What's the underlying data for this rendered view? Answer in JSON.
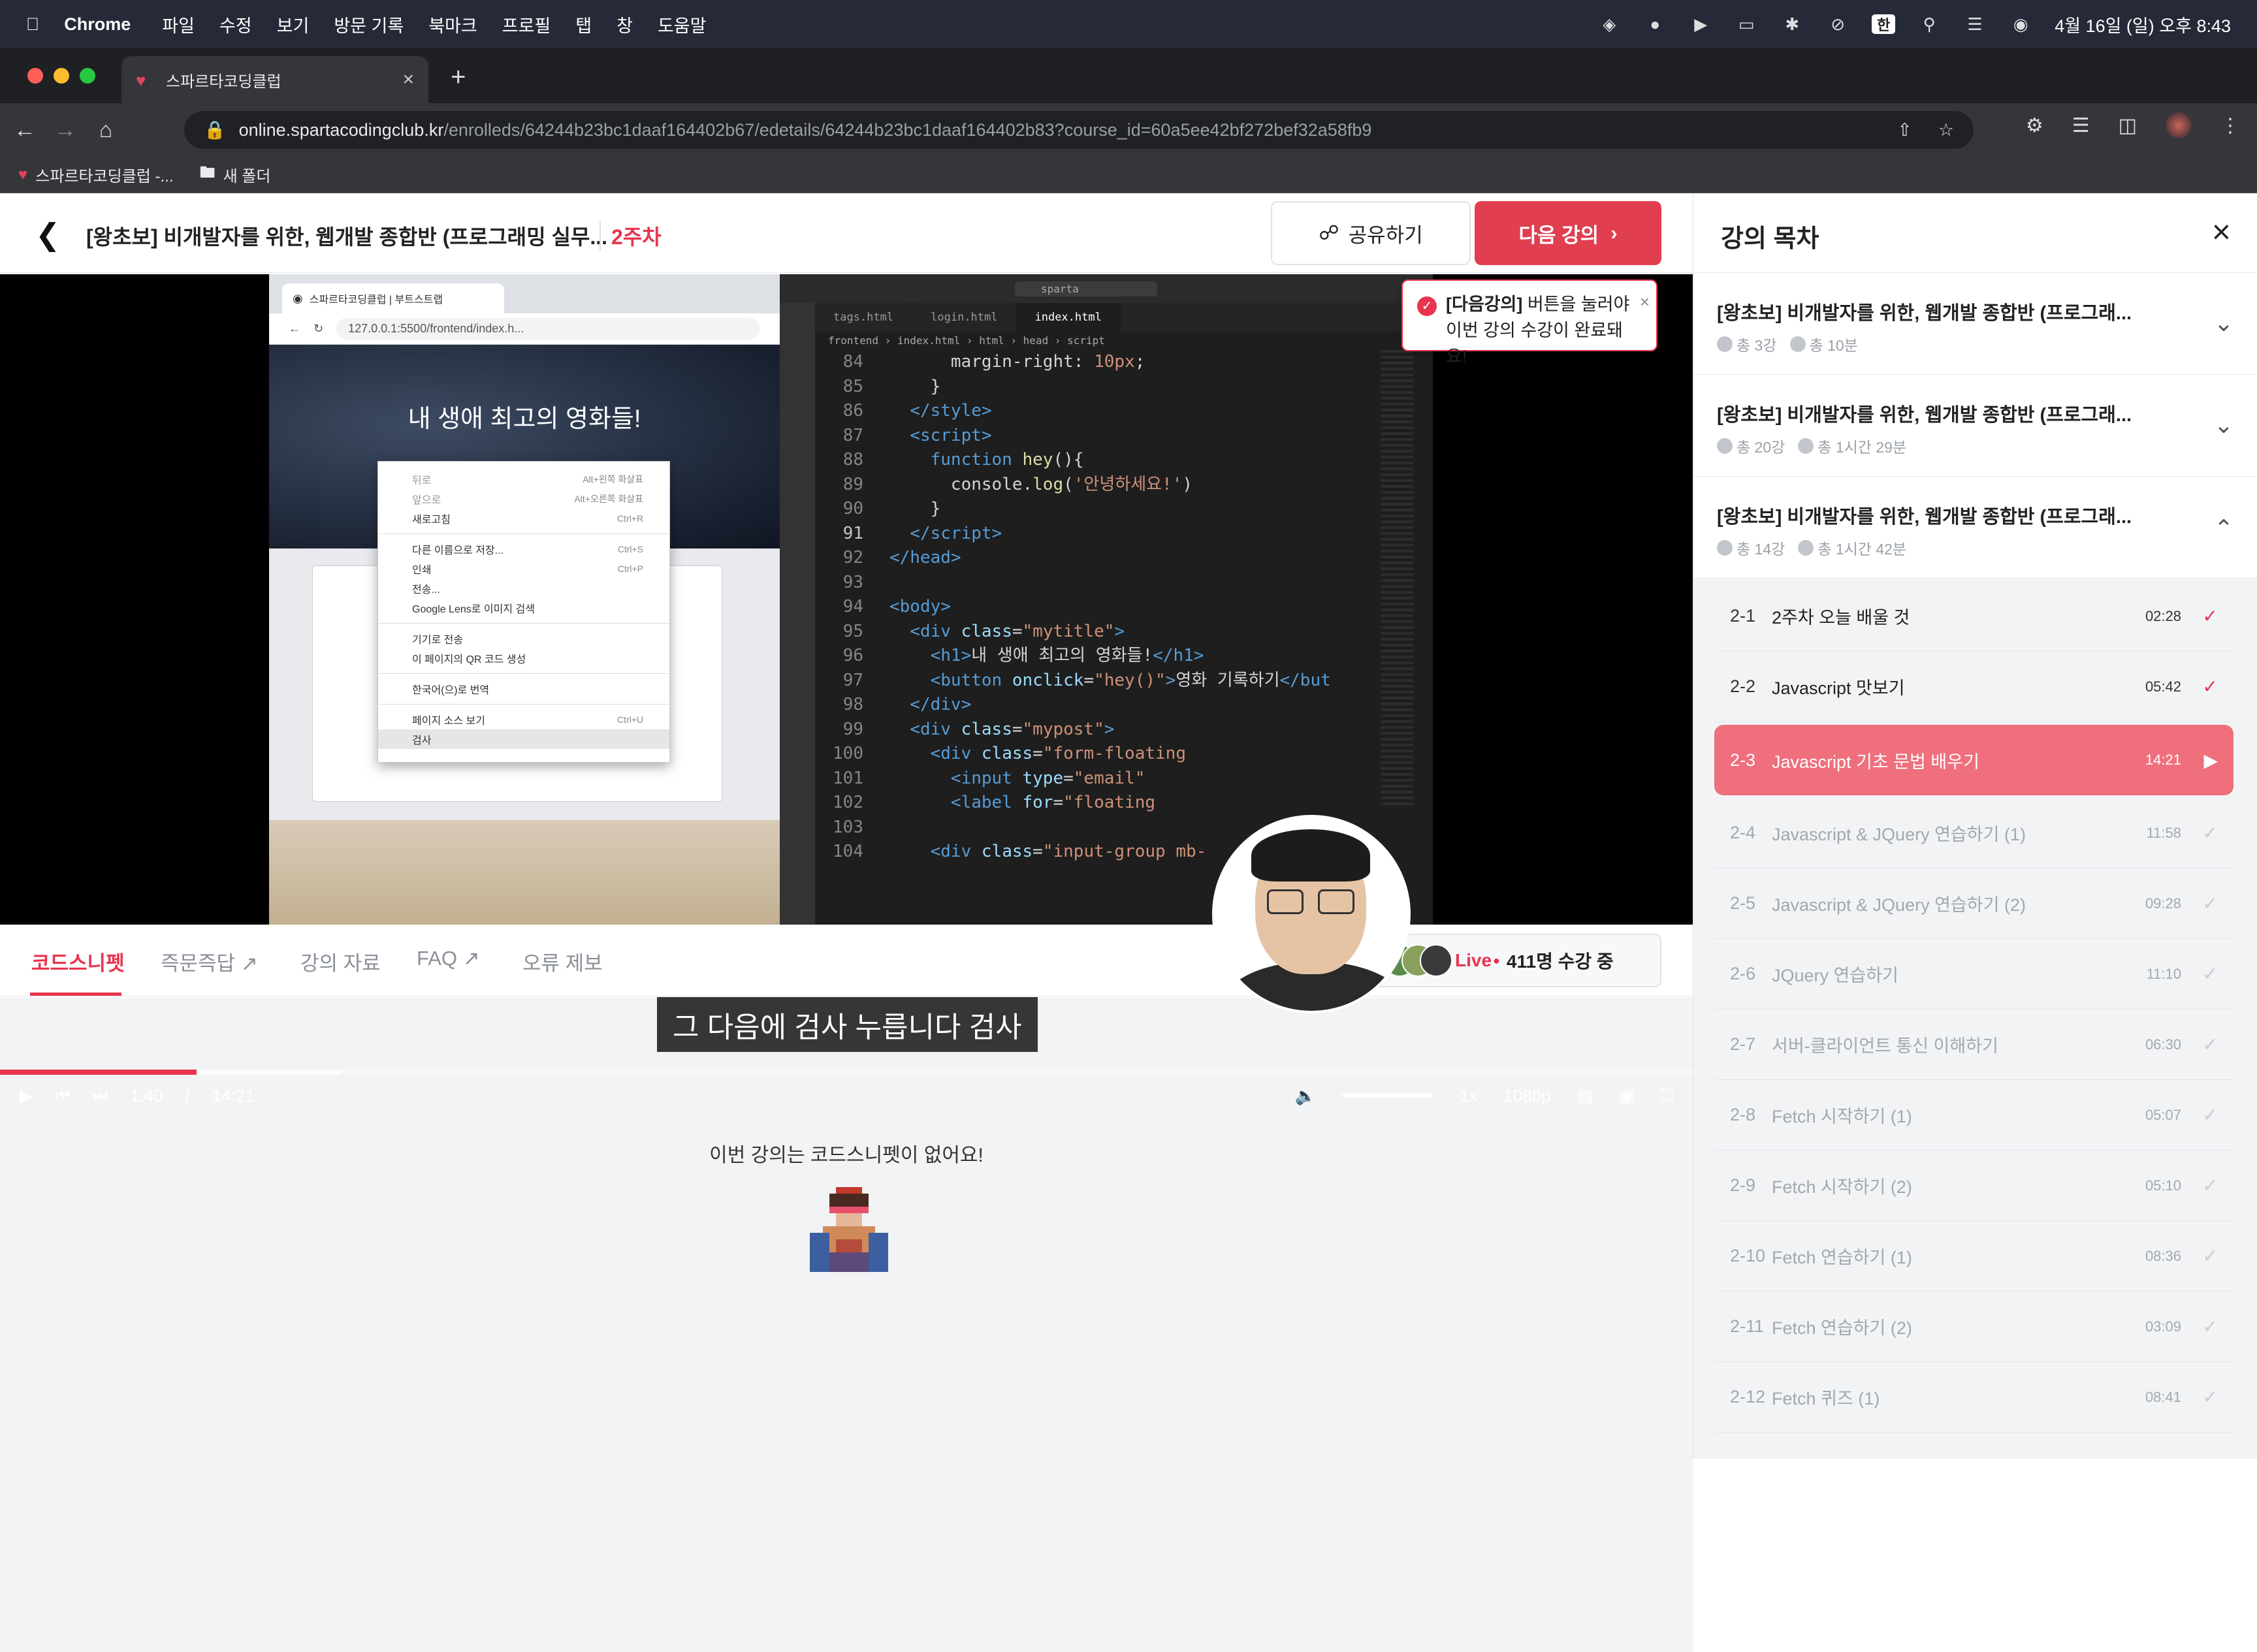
{
  "menubar": {
    "app": "Chrome",
    "items": [
      "파일",
      "수정",
      "보기",
      "방문 기록",
      "북마크",
      "프로필",
      "탭",
      "창",
      "도움말"
    ],
    "input_indicator": "한",
    "datetime": "4월 16일 (일) 오후 8:43"
  },
  "browser": {
    "tab_title": "스파르타코딩클럽",
    "url_host": "online.spartacodingclub.kr",
    "url_path": "/enrolleds/64244b23bc1daaf164402b67/edetails/64244b23bc1daaf164402b83?course_id=60a5ee42bf272bef32a58fb9",
    "bookmarks": [
      "스파르타코딩클럽 -...",
      "새 폴더"
    ]
  },
  "header": {
    "course_title": "[왕초보] 비개발자를 위한, 웹개발 종합반 (프로그래밍 실무...",
    "week": "2주차",
    "share_label": "공유하기",
    "next_label": "다음 강의",
    "tooltip_bold": "[다음강의]",
    "tooltip_line1": " 버튼을 눌러야",
    "tooltip_line2": "이번 강의 수강이 완료돼요!"
  },
  "video": {
    "inner_browser": {
      "tab": "스파르타코딩클럽 | 부트스트랩",
      "url": "127.0.0.1:5500/frontend/index.h...",
      "hero_title": "내 생애 최고의 영화들!",
      "context_menu": [
        {
          "label": "뒤로",
          "key": "Alt+왼쪽 화살표"
        },
        {
          "label": "앞으로",
          "key": "Alt+오른쪽 화살표"
        },
        {
          "label": "새로고침",
          "key": "Ctrl+R"
        },
        {
          "label": "다른 이름으로 저장...",
          "key": "Ctrl+S"
        },
        {
          "label": "인쇄",
          "key": "Ctrl+P"
        },
        {
          "label": "전송...",
          "key": ""
        },
        {
          "label": "Google Lens로 이미지 검색",
          "key": ""
        },
        {
          "label": "기기로 전송",
          "key": ""
        },
        {
          "label": "이 페이지의 QR 코드 생성",
          "key": ""
        },
        {
          "label": "한국어(으)로 번역",
          "key": ""
        },
        {
          "label": "페이지 소스 보기",
          "key": "Ctrl+U"
        },
        {
          "label": "검사",
          "key": ""
        }
      ]
    },
    "vscode": {
      "search": "sparta",
      "tabs": [
        "tags.html",
        "login.html",
        "index.html"
      ],
      "breadcrumb": "frontend › index.html › html › head › script"
    },
    "subtitle": "그 다음에 검사 누릅니다 검사",
    "time_current": "1:40",
    "time_total": "14:21",
    "speed": "1x",
    "quality": "1080p",
    "progress_played": 0.116
  },
  "page_tabs": {
    "items": [
      "코드스니펫",
      "즉문즉답",
      "강의 자료",
      "FAQ",
      "오류 제보"
    ],
    "live_label": "Live",
    "live_count": "411명 수강 중"
  },
  "snippet": {
    "empty_text": "이번 강의는 코드스니펫이 없어요!"
  },
  "sidebar": {
    "title": "강의 목차",
    "sections": [
      {
        "title": "[왕초보] 비개발자를 위한, 웹개발 종합반 (프로그래...",
        "count": "총 3강",
        "duration": "총 10분",
        "expanded": false
      },
      {
        "title": "[왕초보] 비개발자를 위한, 웹개발 종합반 (프로그래...",
        "count": "총 20강",
        "duration": "총 1시간 29분",
        "expanded": false
      },
      {
        "title": "[왕초보] 비개발자를 위한, 웹개발 종합반 (프로그래...",
        "count": "총 14강",
        "duration": "총 1시간 42분",
        "expanded": true
      }
    ],
    "lessons": [
      {
        "num": "2-1",
        "title": "2주차 오늘 배울 것",
        "duration": "02:28",
        "state": "done"
      },
      {
        "num": "2-2",
        "title": "Javascript 맛보기",
        "duration": "05:42",
        "state": "done"
      },
      {
        "num": "2-3",
        "title": "Javascript 기초 문법 배우기",
        "duration": "14:21",
        "state": "current"
      },
      {
        "num": "2-4",
        "title": "Javascript & JQuery 연습하기 (1)",
        "duration": "11:58",
        "state": "todo"
      },
      {
        "num": "2-5",
        "title": "Javascript & JQuery 연습하기 (2)",
        "duration": "09:28",
        "state": "todo"
      },
      {
        "num": "2-6",
        "title": "JQuery 연습하기",
        "duration": "11:10",
        "state": "todo"
      },
      {
        "num": "2-7",
        "title": "서버-클라이언트 통신 이해하기",
        "duration": "06:30",
        "state": "todo"
      },
      {
        "num": "2-8",
        "title": "Fetch 시작하기 (1)",
        "duration": "05:07",
        "state": "todo"
      },
      {
        "num": "2-9",
        "title": "Fetch 시작하기 (2)",
        "duration": "05:10",
        "state": "todo"
      },
      {
        "num": "2-10",
        "title": "Fetch 연습하기 (1)",
        "duration": "08:36",
        "state": "todo"
      },
      {
        "num": "2-11",
        "title": "Fetch 연습하기 (2)",
        "duration": "03:09",
        "state": "todo"
      },
      {
        "num": "2-12",
        "title": "Fetch 퀴즈 (1)",
        "duration": "08:41",
        "state": "todo"
      }
    ]
  },
  "colors": {
    "accent": "#e8344e",
    "next_button": "#e13e4f",
    "current_lesson": "#ef6f7c"
  }
}
